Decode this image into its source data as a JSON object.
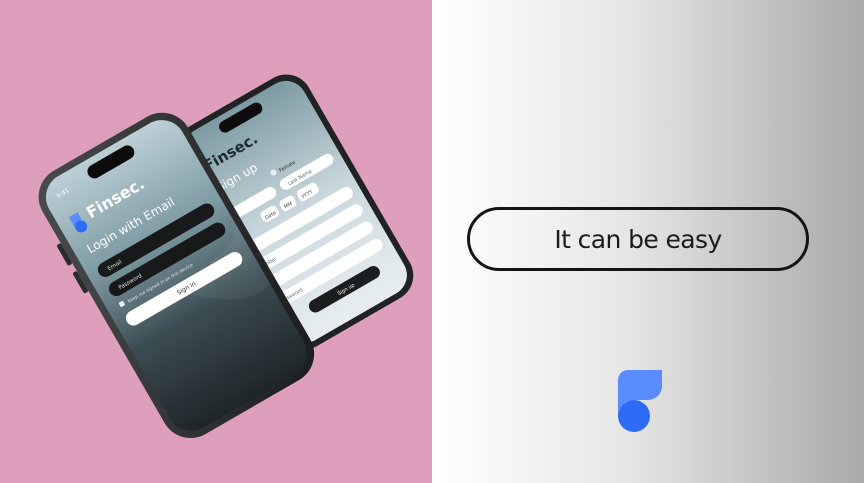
{
  "colors": {
    "left_background": "#de9fbd",
    "brand_blue": "#2f6cf6",
    "brand_blue_light": "#5b8cff",
    "pill_border": "#141414"
  },
  "front_phone": {
    "status_time": "9:41",
    "app_name": "Finsec.",
    "heading": "Login with Email",
    "email_placeholder": "Email",
    "password_placeholder": "Password",
    "keep_signed_label": "Keep me signed in on this device",
    "sign_in_label": "Sign in"
  },
  "back_phone": {
    "app_name": "Finsec.",
    "heading": "Sign up",
    "gender_option": "Female",
    "last_name_placeholder": "Last Name",
    "dob_day": "Date",
    "dob_month": "MM",
    "dob_year": "YYYY",
    "number_label": "umber",
    "address_label": "ss",
    "password_label": "Password",
    "sign_up_label": "Sign up"
  },
  "tagline": "It can be easy",
  "logo_icon": "finsec-logo-icon"
}
